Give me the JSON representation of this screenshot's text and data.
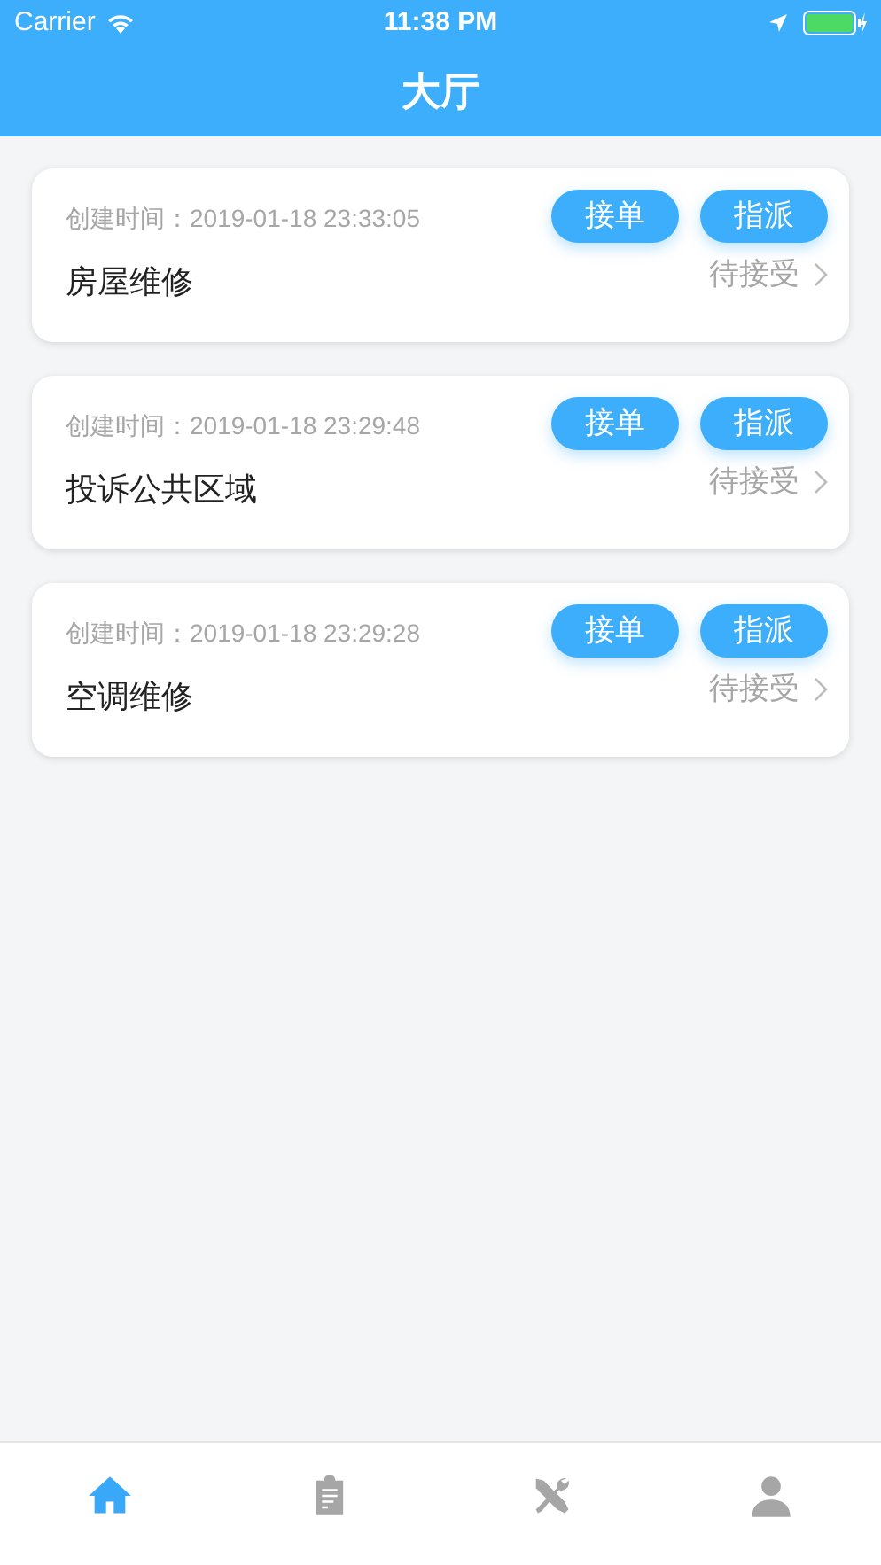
{
  "status_bar": {
    "carrier": "Carrier",
    "time": "11:38 PM"
  },
  "nav": {
    "title": "大厅"
  },
  "orders": [
    {
      "created": "创建时间：2019-01-18 23:33:05",
      "title": "房屋维修",
      "accept": "接单",
      "assign": "指派",
      "status": "待接受"
    },
    {
      "created": "创建时间：2019-01-18 23:29:48",
      "title": "投诉公共区域",
      "accept": "接单",
      "assign": "指派",
      "status": "待接受"
    },
    {
      "created": "创建时间：2019-01-18 23:29:28",
      "title": "空调维修",
      "accept": "接单",
      "assign": "指派",
      "status": "待接受"
    }
  ],
  "tab_bar": [
    {
      "kind": "home",
      "selected": true
    },
    {
      "kind": "clipboard",
      "selected": false
    },
    {
      "kind": "tools",
      "selected": false
    },
    {
      "kind": "user",
      "selected": false
    }
  ]
}
